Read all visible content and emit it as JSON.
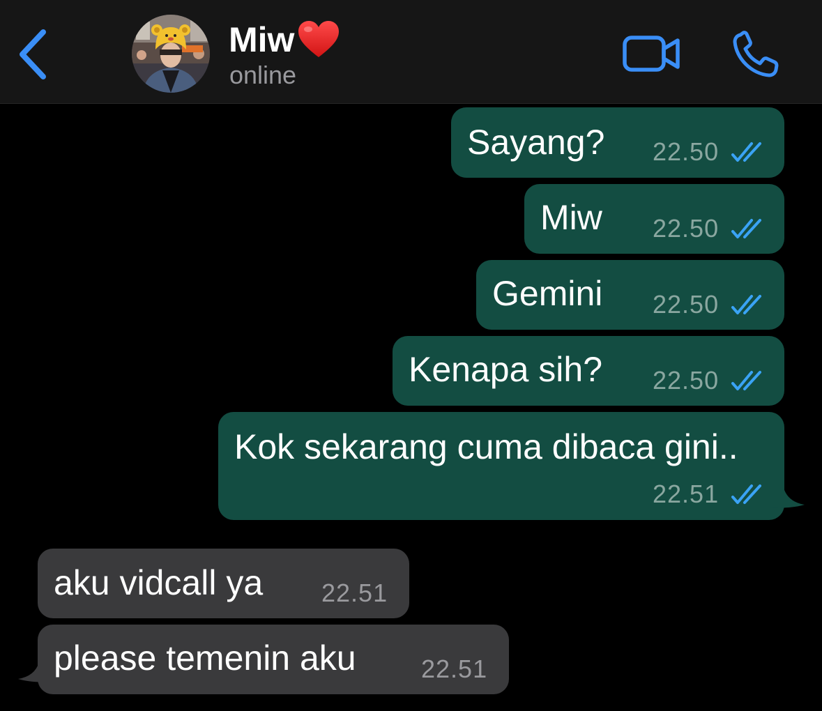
{
  "header": {
    "back_icon": "chevron-left-icon",
    "contact_name": "Miw",
    "name_emoji_icon": "red-heart-icon",
    "status": "online",
    "video_icon": "video-camera-icon",
    "phone_icon": "phone-icon"
  },
  "colors": {
    "accent": "#3a8ef6",
    "outgoing_bubble": "#134d42",
    "incoming_bubble": "#3a3a3c",
    "read_ticks": "#3aa3f5",
    "header_bg": "#161616",
    "background": "#000000"
  },
  "messages": [
    {
      "direction": "outgoing",
      "text": "Sayang?",
      "time": "22.50",
      "status": "read"
    },
    {
      "direction": "outgoing",
      "text": "Miw",
      "time": "22.50",
      "status": "read"
    },
    {
      "direction": "outgoing",
      "text": "Gemini",
      "time": "22.50",
      "status": "read"
    },
    {
      "direction": "outgoing",
      "text": "Kenapa sih?",
      "time": "22.50",
      "status": "read"
    },
    {
      "direction": "outgoing",
      "text": "Kok sekarang cuma dibaca gini..",
      "time": "22.51",
      "status": "read"
    },
    {
      "direction": "incoming",
      "text": "aku vidcall ya",
      "time": "22.51"
    },
    {
      "direction": "incoming",
      "text": "please temenin aku",
      "time": "22.51"
    }
  ]
}
